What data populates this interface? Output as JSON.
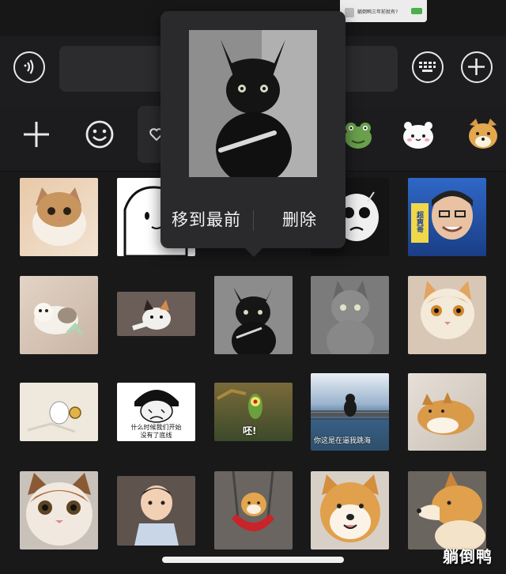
{
  "chat_preview": {
    "text": "躺倒鸭三年前就有?"
  },
  "input": {
    "placeholder": ""
  },
  "popup": {
    "move_to_front": "移到最前",
    "delete": "删除"
  },
  "stickers": {
    "cap1": "什么时候我们开始\n没有了底线",
    "cap2": "呸!",
    "cap3": "你这是在逼我跳海",
    "cap4": "超爽哥"
  },
  "watermark": "躺倒鸭",
  "colors": {
    "bg": "#1d1d1f",
    "popup": "#2a2a2c",
    "accent": "#4cae4c"
  }
}
